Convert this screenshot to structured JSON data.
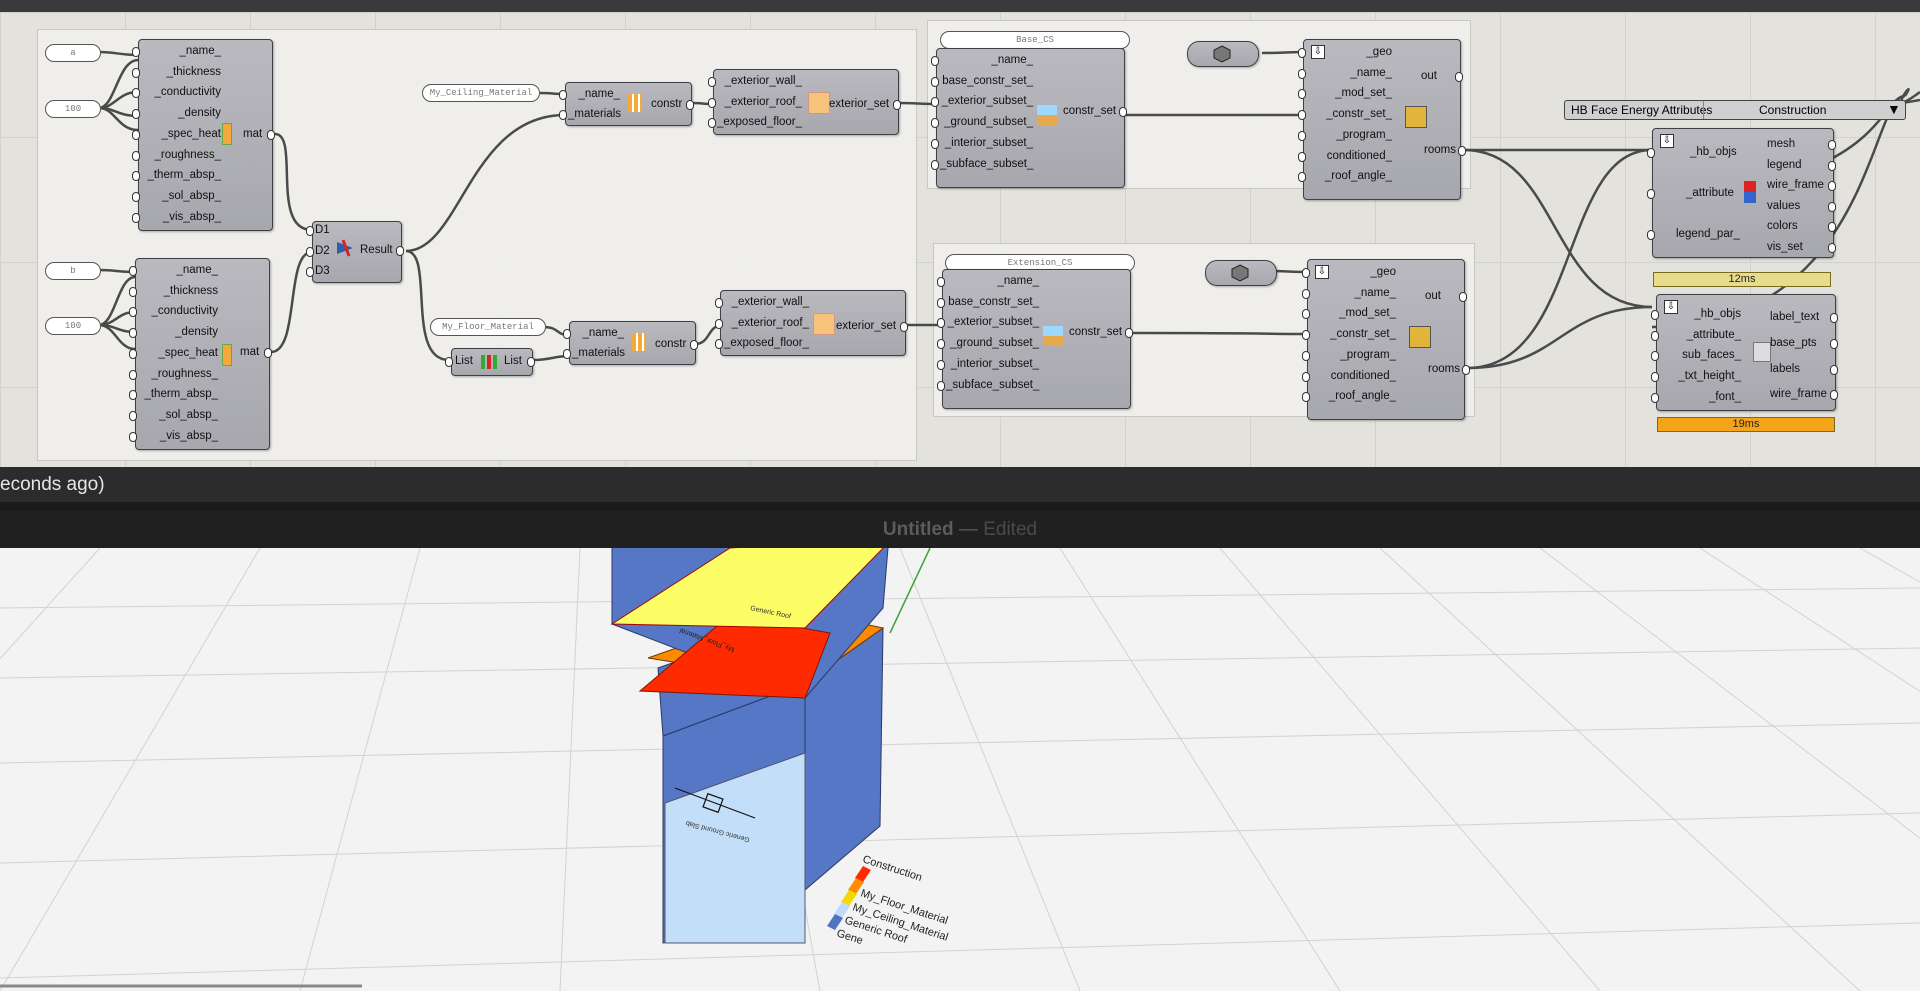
{
  "status": {
    "text": "econds ago)"
  },
  "window": {
    "title": "Untitled",
    "dash": "—",
    "state": "Edited"
  },
  "panels": {
    "a": "a",
    "b": "b",
    "n100a": "100",
    "n100b": "100",
    "ceiling": "My_Ceiling_Material",
    "floor": "My_Floor_Material",
    "base_cs": "Base_CS",
    "ext_cs": "Extension_CS"
  },
  "material": {
    "inputs": [
      "_name_",
      "_thickness",
      "_conductivity",
      "_density",
      "_spec_heat",
      "_roughness_",
      "_therm_absp_",
      "_sol_absp_",
      "_vis_absp_"
    ],
    "output": "mat"
  },
  "merge": {
    "inputs": [
      "D1",
      "D2",
      "D3"
    ],
    "output": "Result"
  },
  "list_item": {
    "input": "List",
    "output": "List"
  },
  "construction": {
    "inputs": [
      "_name_",
      "_materials"
    ],
    "output": "constr"
  },
  "exterior_set": {
    "inputs": [
      "_exterior_wall_",
      "_exterior_roof_",
      "_exposed_floor_"
    ],
    "output": "exterior_set"
  },
  "constr_set": {
    "inputs": [
      "_name_",
      "base_constr_set_",
      "_exterior_subset_",
      "_ground_subset_",
      "_interior_subset_",
      "_subface_subset_"
    ],
    "output": "constr_set"
  },
  "apply_set": {
    "inputs": [
      "_geo",
      "_name_",
      "_mod_set_",
      "_constr_set_",
      "_program_",
      "conditioned_",
      "_roof_angle_"
    ],
    "outputs": [
      "out",
      "rooms"
    ]
  },
  "value_list": {
    "label": "HB Face Energy Attributes",
    "value": "Construction"
  },
  "color_faces": {
    "inputs": [
      "_hb_objs",
      "_attribute",
      "legend_par_"
    ],
    "outputs": [
      "mesh",
      "legend",
      "wire_frame",
      "values",
      "colors",
      "vis_set"
    ]
  },
  "label_faces": {
    "inputs": [
      "_hb_objs",
      "_attribute_",
      "sub_faces_",
      "_txt_height_",
      "_font_"
    ],
    "outputs": [
      "label_text",
      "base_pts",
      "labels",
      "wire_frame"
    ]
  },
  "timers": {
    "t1": "12ms",
    "t2": "19ms"
  },
  "legend": {
    "title": "Construction",
    "items": [
      "My_Floor_Material",
      "My_Ceiling_Material",
      "Generic Roof",
      "Gene"
    ],
    "colors": [
      "#ff2a00",
      "#ff8c00",
      "#f5d800",
      "#bfdcff",
      "#5174c1"
    ]
  },
  "faces": {
    "roof_top": "Generic Roof",
    "red_floor": "My_Floor_Material",
    "lower_face": "Generic Ground Slab"
  },
  "colors": {
    "canvas": "#e3e2dd",
    "node": "#b0b0b6",
    "wire": "#4a4a4a",
    "yellow": "#fdfd66",
    "blue": "#5577c5",
    "red": "#ff2a00",
    "orange": "#ff8a00",
    "light_blue": "#c2def9"
  }
}
